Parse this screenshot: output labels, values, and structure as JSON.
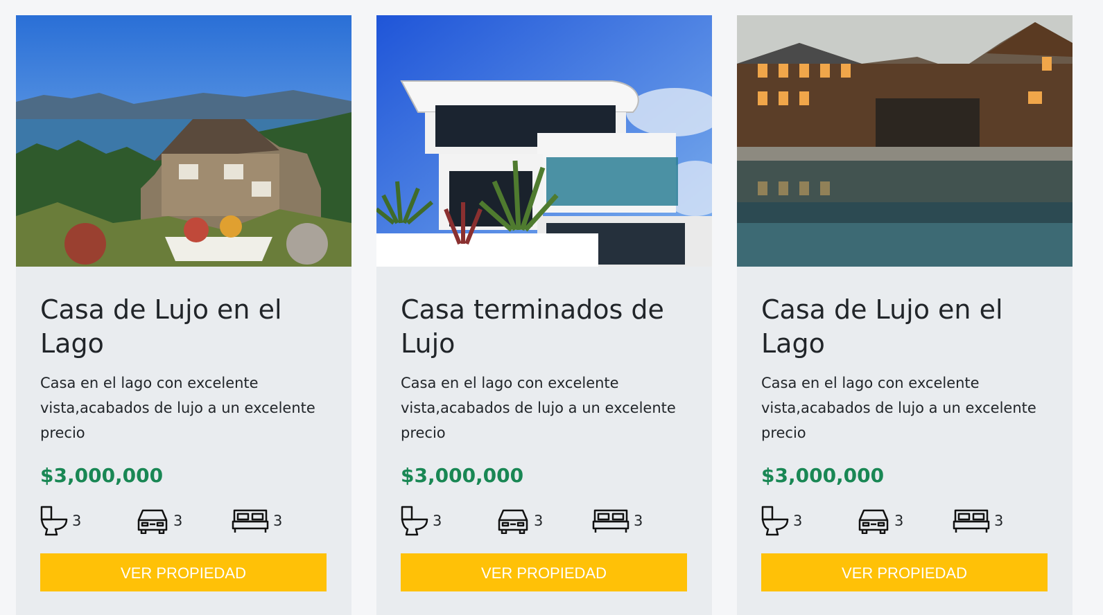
{
  "properties": [
    {
      "title": "Casa de Lujo en el Lago",
      "description": "Casa en el lago con excelente vista,acabados de lujo a un excelente precio",
      "price": "$3,000,000",
      "bathrooms": "3",
      "parking": "3",
      "bedrooms": "3",
      "button_label": "VER PROPIEDAD",
      "image": "lake-house-photo"
    },
    {
      "title": "Casa terminados de Lujo",
      "description": "Casa en el lago con excelente vista,acabados de lujo a un excelente precio",
      "price": "$3,000,000",
      "bathrooms": "3",
      "parking": "3",
      "bedrooms": "3",
      "button_label": "VER PROPIEDAD",
      "image": "modern-house-photo"
    },
    {
      "title": "Casa de Lujo en el Lago",
      "description": "Casa en el lago con excelente vista,acabados de lujo a un excelente precio",
      "price": "$3,000,000",
      "bathrooms": "3",
      "parking": "3",
      "bedrooms": "3",
      "button_label": "VER PROPIEDAD",
      "image": "pool-house-photo"
    }
  ],
  "icons": {
    "bathroom": "toilet-icon",
    "parking": "car-icon",
    "bedroom": "bed-icon"
  },
  "colors": {
    "price": "#198754",
    "button": "#ffc107",
    "card_bg": "#e9ecef"
  }
}
